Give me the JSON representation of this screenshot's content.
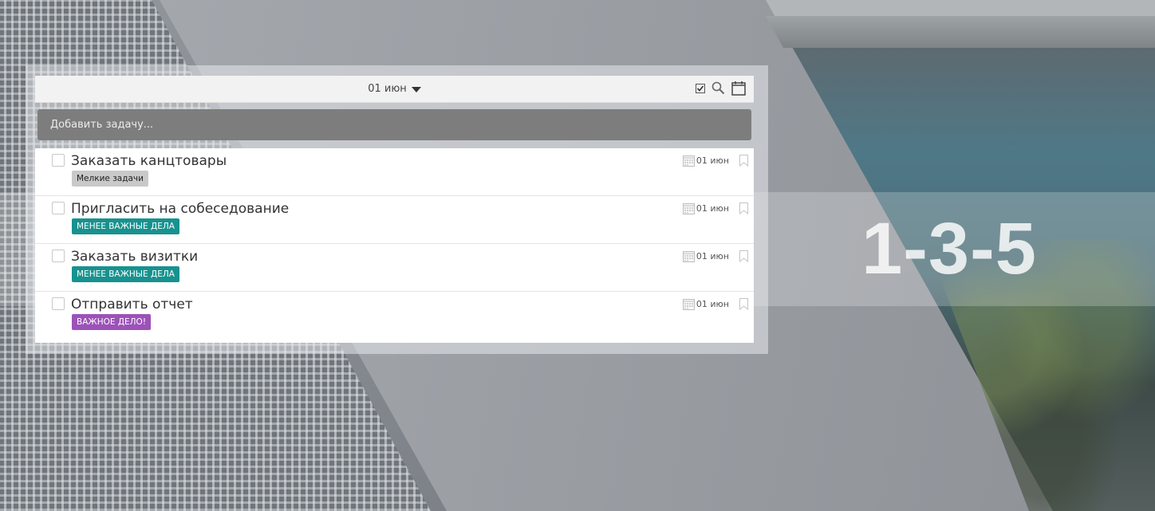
{
  "brand": {
    "text": "1-3-5"
  },
  "header": {
    "date_label": "01 июн",
    "icons": [
      "checkbox-icon",
      "search-icon",
      "calendar-icon"
    ]
  },
  "add_task": {
    "placeholder": "Добавить задачу..."
  },
  "tasks": [
    {
      "title": "Заказать канцтовары",
      "tag": "Мелкие задачи",
      "tag_bg": "#c9c9c9",
      "tag_color": "#222222",
      "due": "01 июн"
    },
    {
      "title": "Пригласить на собеседование",
      "tag": "МЕНЕЕ ВАЖНЫЕ ДЕЛА",
      "tag_bg": "#17928f",
      "tag_color": "#ffffff",
      "due": "01 июн"
    },
    {
      "title": "Заказать визитки",
      "tag": "МЕНЕЕ ВАЖНЫЕ ДЕЛА",
      "tag_bg": "#17928f",
      "tag_color": "#ffffff",
      "due": "01 июн"
    },
    {
      "title": "Отправить отчет",
      "tag": "ВАЖНОЕ ДЕЛО!",
      "tag_bg": "#9c52b8",
      "tag_color": "#ffffff",
      "due": "01 июн"
    }
  ]
}
